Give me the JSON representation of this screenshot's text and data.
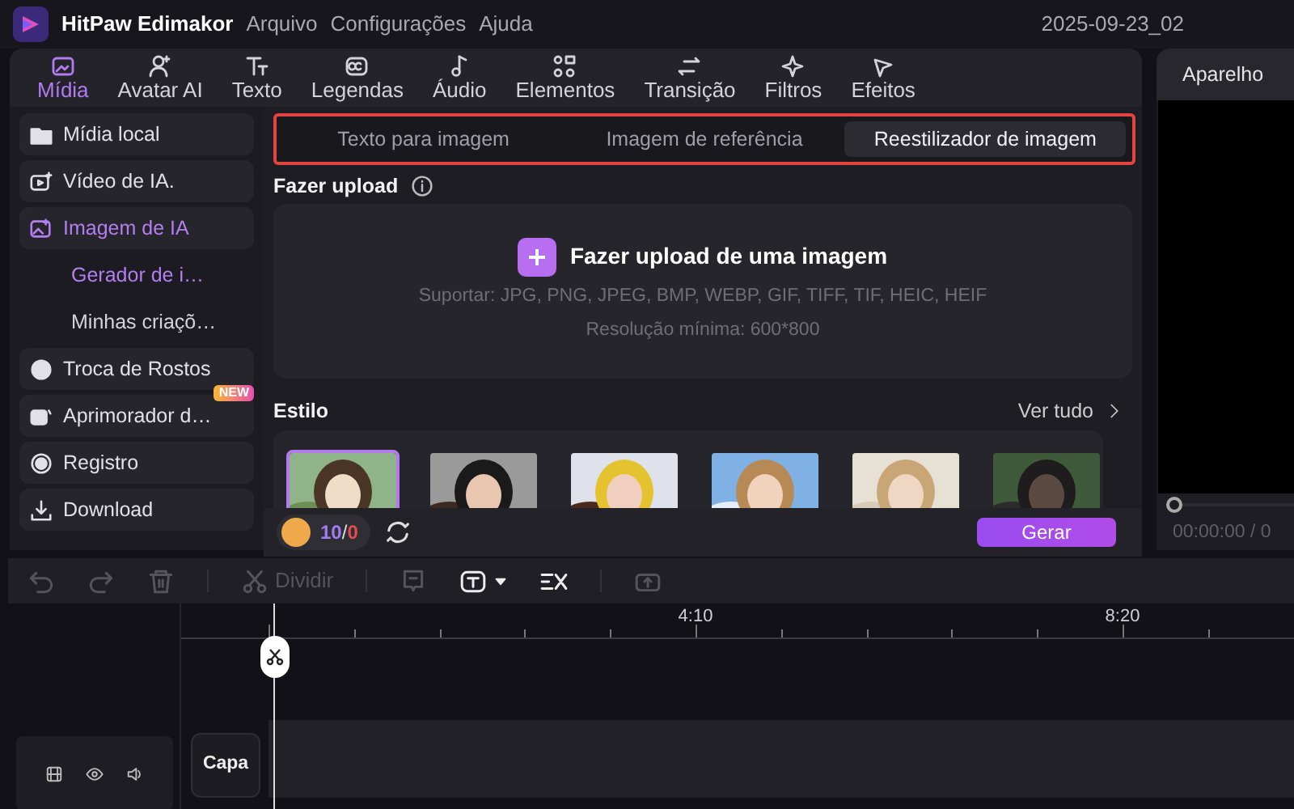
{
  "titlebar": {
    "app_name": "HitPaw Edimakor",
    "menu": [
      "Arquivo",
      "Configurações",
      "Ajuda"
    ],
    "project": "2025-09-23_02"
  },
  "tabs": [
    {
      "label": "Mídia",
      "selected": true
    },
    {
      "label": "Avatar AI",
      "selected": false
    },
    {
      "label": "Texto",
      "selected": false
    },
    {
      "label": "Legendas",
      "selected": false
    },
    {
      "label": "Áudio",
      "selected": false
    },
    {
      "label": "Elementos",
      "selected": false
    },
    {
      "label": "Transição",
      "selected": false
    },
    {
      "label": "Filtros",
      "selected": false
    },
    {
      "label": "Efeitos",
      "selected": false
    }
  ],
  "sidebar": {
    "items": [
      {
        "label": "Mídia local",
        "selected": false
      },
      {
        "label": "Vídeo de IA.",
        "selected": false
      },
      {
        "label": "Imagem de IA",
        "selected": true,
        "children": [
          {
            "label": "Gerador de i…",
            "selected": true
          },
          {
            "label": "Minhas criaçõ…",
            "selected": false
          }
        ]
      },
      {
        "label": "Troca de Rostos",
        "selected": false
      },
      {
        "label": "Aprimorador d…",
        "selected": false,
        "badge": "NEW"
      },
      {
        "label": "Registro",
        "selected": false
      },
      {
        "label": "Download",
        "selected": false
      }
    ]
  },
  "mode_tabs": [
    {
      "label": "Texto para imagem",
      "selected": false
    },
    {
      "label": "Imagem de referência",
      "selected": false
    },
    {
      "label": "Reestilizador de imagem",
      "selected": true
    }
  ],
  "upload": {
    "heading": "Fazer upload",
    "button": "Fazer upload de uma imagem",
    "formats": "Suportar: JPG, PNG, JPEG, BMP, WEBP, GIF, TIFF, TIF, HEIC, HEIF",
    "min_resolution": "Resolução mínima: 600*800"
  },
  "style": {
    "heading": "Estilo",
    "see_all": "Ver tudo",
    "thumbnails": [
      {
        "kind": "picture",
        "selected": true
      },
      {
        "kind": "picture",
        "selected": false
      },
      {
        "kind": "picture",
        "selected": false
      },
      {
        "kind": "picture",
        "selected": false
      },
      {
        "kind": "picture",
        "selected": false
      },
      {
        "kind": "picture",
        "selected": false
      }
    ]
  },
  "footer": {
    "credits_left": "10",
    "credits_sep": "/",
    "credits_total": "0",
    "generate": "Gerar"
  },
  "preview": {
    "title": "Aparelho",
    "level": 0,
    "time": "00:00:00 / 0"
  },
  "timeline": {
    "tools": [
      {
        "kind": "undo",
        "disabled": true
      },
      {
        "kind": "redo",
        "disabled": true
      },
      {
        "kind": "delete",
        "disabled": true
      },
      {
        "kind": "split",
        "label": "Dividir",
        "disabled": true
      },
      {
        "kind": "caption",
        "disabled": true
      },
      {
        "kind": "text",
        "disabled": false
      },
      {
        "kind": "cut",
        "disabled": false
      },
      {
        "kind": "export",
        "disabled": true
      }
    ],
    "ruler_labels": [
      "4:10",
      "8:20"
    ],
    "track_label": "Capa"
  }
}
